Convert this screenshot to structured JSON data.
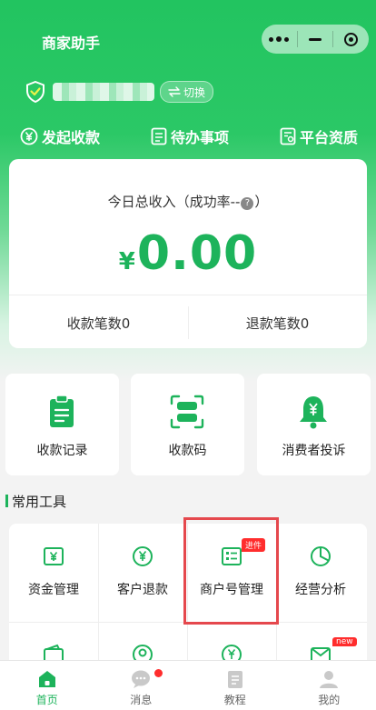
{
  "app": {
    "title": "商家助手"
  },
  "merchant": {
    "switch_label": "切换"
  },
  "quick_actions": [
    {
      "label": "发起收款",
      "icon": "yen-circle-icon"
    },
    {
      "label": "待办事项",
      "icon": "todo-list-icon"
    },
    {
      "label": "平台资质",
      "icon": "certificate-icon"
    }
  ],
  "income": {
    "title_prefix": "今日总收入（成功率--",
    "title_suffix": "）",
    "help": "?",
    "currency": "¥",
    "amount": "0.00",
    "receipts_label": "收款笔数0",
    "refunds_label": "退款笔数0"
  },
  "tiles": [
    {
      "label": "收款记录",
      "icon": "clipboard-icon"
    },
    {
      "label": "收款码",
      "icon": "scan-code-icon"
    },
    {
      "label": "消费者投诉",
      "icon": "bell-yen-icon"
    }
  ],
  "tools": {
    "section_title": "常用工具",
    "items": [
      {
        "label": "资金管理",
        "icon": "yen-square-icon"
      },
      {
        "label": "客户退款",
        "icon": "yen-circle-icon"
      },
      {
        "label": "商户号管理",
        "icon": "id-card-icon",
        "badge": "进件"
      },
      {
        "label": "经营分析",
        "icon": "pie-chart-icon"
      }
    ],
    "second_row_icons": [
      "wallet-icon",
      "user-circle-icon",
      "yen-coin-icon",
      "mail-icon"
    ],
    "second_row_badge": "new"
  },
  "tabbar": [
    {
      "label": "首页",
      "icon": "home-icon",
      "active": true
    },
    {
      "label": "消息",
      "icon": "chat-icon",
      "active": false,
      "has_dot": true
    },
    {
      "label": "教程",
      "icon": "book-icon",
      "active": false
    },
    {
      "label": "我的",
      "icon": "person-icon",
      "active": false
    }
  ],
  "colors": {
    "brand": "#1db35b",
    "header": "#22c460",
    "badge": "#ff2d2d",
    "highlight": "#e5484d"
  }
}
